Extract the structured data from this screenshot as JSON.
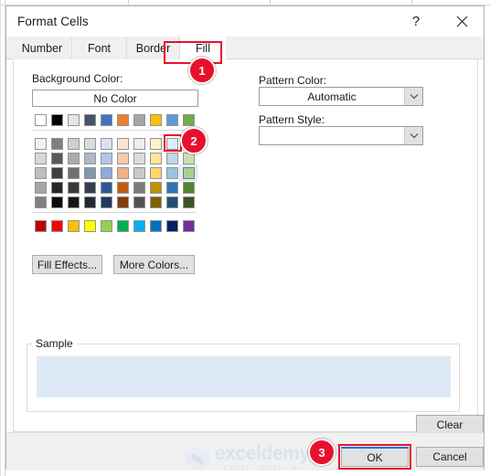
{
  "window": {
    "title": "Format Cells",
    "help_icon": "?",
    "close_icon": "close-icon"
  },
  "tabs": [
    {
      "label": "Number",
      "active": false
    },
    {
      "label": "Font",
      "active": false
    },
    {
      "label": "Border",
      "active": false
    },
    {
      "label": "Fill",
      "active": true
    }
  ],
  "fill_tab": {
    "background_color_label": "Background Color:",
    "background_color_accesskey": "C",
    "no_color_button": "No Color",
    "pattern_color_label": "Pattern Color:",
    "pattern_color_accesskey": "a",
    "pattern_color_value": "Automatic",
    "pattern_style_label": "Pattern Style:",
    "pattern_style_accesskey": "P",
    "pattern_style_value": "",
    "fill_effects_button": "Fill Effects...",
    "fill_effects_accesskey": "i",
    "more_colors_button": "More Colors...",
    "more_colors_accesskey": "M",
    "sample_group_label": "Sample",
    "sample_color": "#ddeaf6",
    "clear_button": "Clear",
    "clear_accesskey": "r"
  },
  "palette": {
    "theme_row": [
      "#ffffff",
      "#000000",
      "#e7e6e6",
      "#44546a",
      "#4472c4",
      "#ed7d31",
      "#a5a5a5",
      "#ffc000",
      "#5b9bd5",
      "#70ad47"
    ],
    "tint_rows": [
      [
        "#f2f2f2",
        "#7f7f7f",
        "#d0cece",
        "#d6dce4",
        "#d9e2f3",
        "#fbe5d5",
        "#ededed",
        "#fff2cc",
        "#ddebf7",
        "#e2efd9"
      ],
      [
        "#d8d8d8",
        "#595959",
        "#aeaaaa",
        "#acb9ca",
        "#b4c6e7",
        "#f7caac",
        "#dbdbdb",
        "#ffe598",
        "#bdd7ee",
        "#c5e0b3"
      ],
      [
        "#bfbfbf",
        "#3f3f3f",
        "#757070",
        "#8496b0",
        "#8faadc",
        "#f4b183",
        "#c9c9c9",
        "#ffd965",
        "#9cc3e5",
        "#a8d08d"
      ],
      [
        "#a6a6a6",
        "#262626",
        "#3a3838",
        "#333f4f",
        "#2f5496",
        "#c55a11",
        "#7b7b7b",
        "#bf9000",
        "#2e75b5",
        "#548235"
      ],
      [
        "#808080",
        "#0c0c0c",
        "#171616",
        "#222a35",
        "#1f3864",
        "#833c0b",
        "#525252",
        "#7f6000",
        "#1f4e79",
        "#375623"
      ]
    ],
    "standard_row": [
      "#c00000",
      "#ff0000",
      "#ffc000",
      "#ffff00",
      "#92d050",
      "#00b050",
      "#00b0f0",
      "#0070c0",
      "#002060",
      "#7030a0"
    ],
    "selected_swatch": {
      "row": 1,
      "col": 9,
      "color": "#ddebf7"
    },
    "hovered_swatch": {
      "row": 3,
      "col": 10,
      "color": "#a8d08d"
    }
  },
  "footer": {
    "ok_button": "OK",
    "cancel_button": "Cancel"
  },
  "annotations": {
    "badges": [
      {
        "number": "1",
        "target": "fill-tab"
      },
      {
        "number": "2",
        "target": "selected-color-swatch"
      },
      {
        "number": "3",
        "target": "ok-button"
      }
    ],
    "highlight_color": "#e8112d"
  },
  "watermark": {
    "name": "exceldemy",
    "tagline": "EXCEL · DATA · BI"
  }
}
